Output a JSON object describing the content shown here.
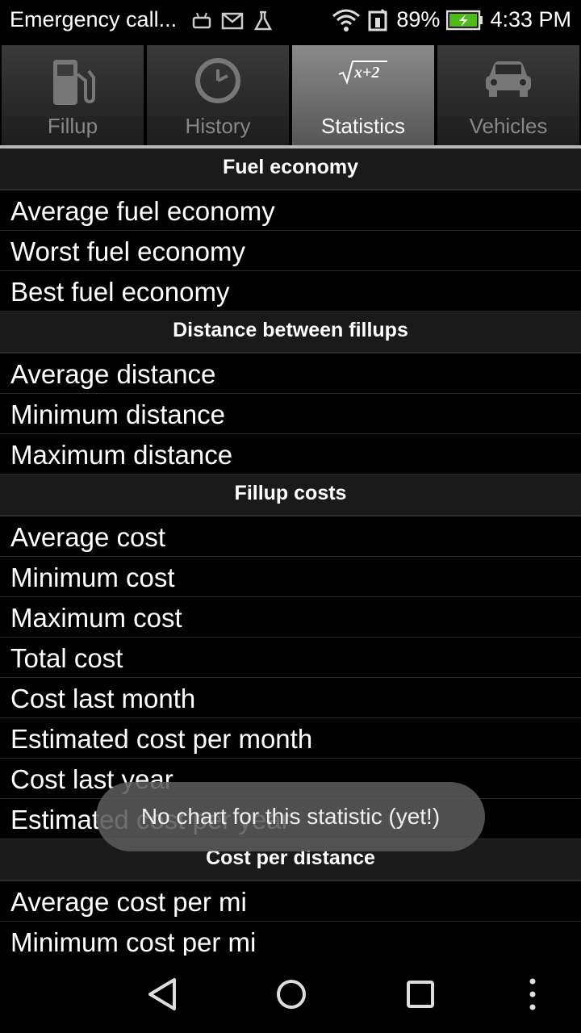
{
  "status_bar": {
    "notification_text": "Emergency call...",
    "battery": "89%",
    "time": "4:33 PM"
  },
  "tabs": [
    {
      "label": "Fillup",
      "icon": "fuel-pump-icon",
      "active": false
    },
    {
      "label": "History",
      "icon": "clock-icon",
      "active": false
    },
    {
      "label": "Statistics",
      "icon": "sqrt-formula-icon",
      "active": true
    },
    {
      "label": "Vehicles",
      "icon": "car-icon",
      "active": false
    }
  ],
  "sections": {
    "fuel_economy": {
      "header": "Fuel economy",
      "rows": [
        "Average fuel economy",
        "Worst fuel economy",
        "Best fuel economy"
      ]
    },
    "distance": {
      "header": "Distance between fillups",
      "rows": [
        "Average distance",
        "Minimum distance",
        "Maximum distance"
      ]
    },
    "costs": {
      "header": "Fillup costs",
      "rows": [
        "Average cost",
        "Minimum cost",
        "Maximum cost",
        "Total cost",
        "Cost last month",
        "Estimated cost per month",
        "Cost last year",
        "Estimated cost per year"
      ]
    },
    "cost_per_distance": {
      "header": "Cost per distance",
      "rows": [
        "Average cost per mi",
        "Minimum cost per mi"
      ]
    }
  },
  "toast": {
    "text": "No chart for this statistic (yet!)"
  },
  "colors": {
    "background": "#000000",
    "section_header_bg": "#1a1a1a",
    "active_tab": "#777777",
    "battery_green": "#4cbb17"
  }
}
